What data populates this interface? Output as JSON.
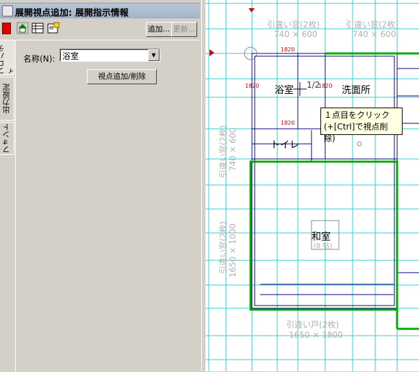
{
  "panel": {
    "title": "展開視点追加: 展開指示情報",
    "add_button": "追加...",
    "update_button": "更新...",
    "tabs": [
      "プロパティ",
      "出力設定",
      "フォント"
    ],
    "name_label": "名称(N):",
    "name_value": "浴室",
    "viewpoint_button": "視点追加/削除",
    "toolbar_icons": [
      "red-stop-icon",
      "house-icon",
      "table-icon",
      "properties-icon"
    ]
  },
  "drawing": {
    "window_top_left": "引違い窓(2枚)",
    "window_top_left_size": "740 × 600",
    "window_top_right": "引違い窓(2枚)",
    "window_top_right_size": "740 × 600",
    "window_left_upper": "引違い窓(2枚)",
    "window_left_upper_size": "740 × 600",
    "window_left_lower": "引違い窓(2枚)",
    "window_left_lower_size": "1650 × 1000",
    "window_bottom": "引違い戸(2枚)",
    "window_bottom_size": "1650 × 1800",
    "room_bath": "浴室",
    "room_wash": "洗面所",
    "room_toilet": "トイレ",
    "room_washitsu": "和室",
    "room_washitsu_sub": "(8 帖)",
    "dim_top_bath": "1820",
    "dim_top_wash": "1820",
    "dim_left": "1820",
    "dim_mid": "1820",
    "dim_mid2": "1820",
    "cursor_label": "1/2"
  },
  "tooltip": {
    "line1": "１点目をクリック",
    "line2": "(+[Ctrl]で視点削除)"
  },
  "colors": {
    "grid": "#33cccc",
    "wall": "#000080",
    "highlight": "#00aa00",
    "dim": "#cc0000",
    "label": "#b0b0b0"
  }
}
